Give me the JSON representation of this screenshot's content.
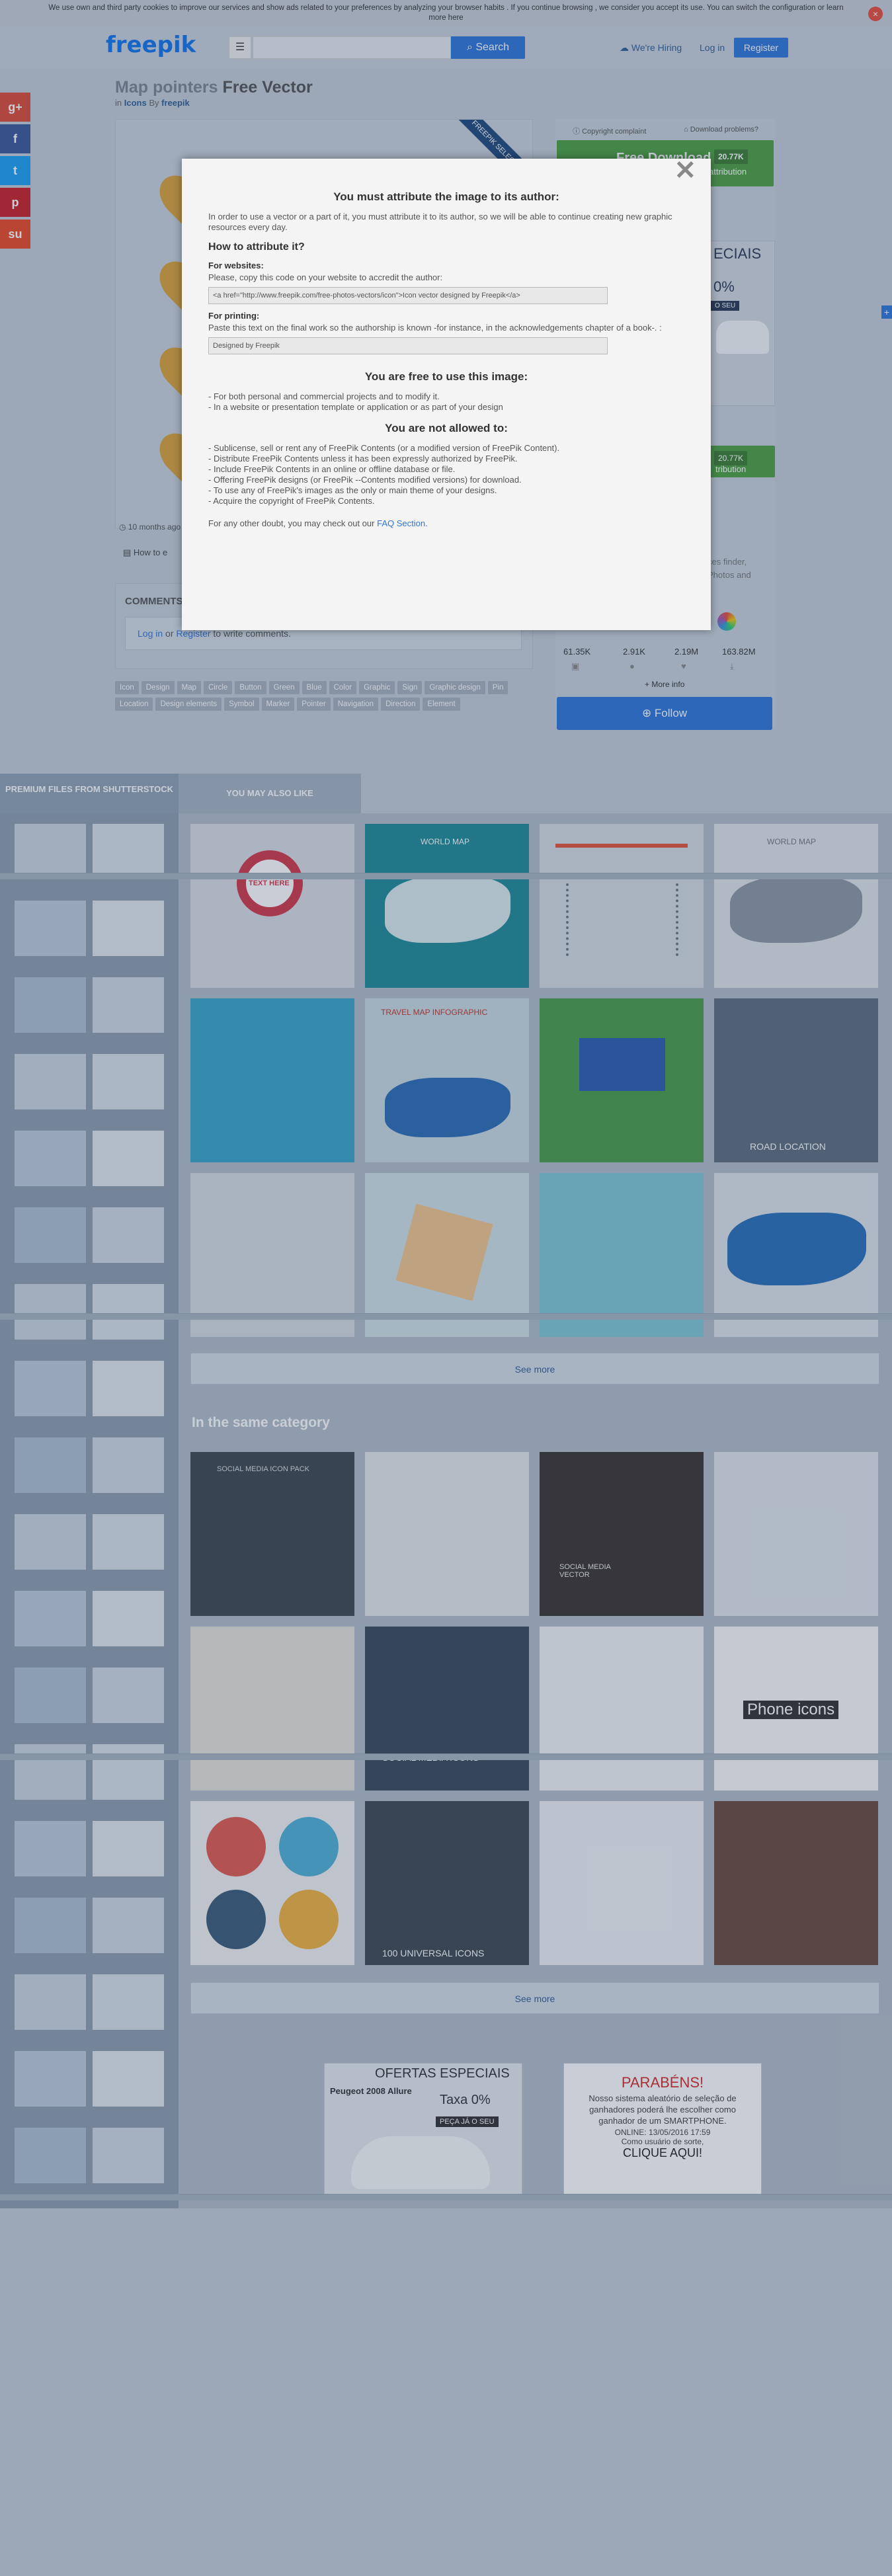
{
  "cookie": {
    "text": "We use own and third party cookies to improve our services and show ads related to your preferences by analyzing your browser habits . If you continue browsing , we consider you accept its use. You can switch the configuration or learn more here",
    "close": "×"
  },
  "header": {
    "logo": "freepik",
    "search_label": "Search",
    "hiring": "We're Hiring",
    "login": "Log in",
    "register": "Register"
  },
  "social": [
    "g+",
    "f",
    "t",
    "p",
    "su"
  ],
  "page": {
    "title_prefix": "Map pointers",
    "title_suffix": "Free Vector",
    "in": "in",
    "category": "Icons",
    "by": "By",
    "author": "freepik",
    "ribbon": "FREEPIK SELECTION",
    "meta": "10 months ago",
    "how_to": "How to e"
  },
  "side": {
    "copyright": "Copyright complaint",
    "download_problems": "Download problems?",
    "download": "Free Download",
    "download_count": "20.77K",
    "attribution": "attribution",
    "count2": "20.77K",
    "attribution2": "tribution",
    "finder_line1": "ces finder,",
    "finder_line2": "Photos and",
    "more_info": "+ More info",
    "follow": "Follow",
    "stats": [
      "61.35K",
      "2.91K",
      "2.19M",
      "163.82M"
    ]
  },
  "ad_side": {
    "headline": "ECIAIS",
    "sub": "0%",
    "cta": "O SEU"
  },
  "comments": {
    "title": "COMMENTS",
    "login": "Log in",
    "or": "or",
    "register": "Register",
    "rest": "to write comments."
  },
  "tags": [
    "Icon",
    "Design",
    "Map",
    "Circle",
    "Button",
    "Green",
    "Blue",
    "Color",
    "Graphic",
    "Sign",
    "Graphic design",
    "Pin",
    "Location",
    "Design elements",
    "Symbol",
    "Marker",
    "Pointer",
    "Navigation",
    "Direction",
    "Element"
  ],
  "sections": {
    "premium": "PREMIUM FILES FROM SHUTTERSTOCK",
    "also_like": "YOU MAY ALSO LIKE",
    "see_more": "See more",
    "same_category": "In the same category"
  },
  "thumb_texts": {
    "t1": "TEXT HERE",
    "t2": "WORLD MAP",
    "t3": "WORLD MAP",
    "t4": "TRAVEL MAP INFOGRAPHIC",
    "t5": "ROAD LOCATION",
    "t6": "SOCIAL MEDIA ICON PACK",
    "t7": "SOCIAL MEDIA VECTOR",
    "t8": "SOCIAL MEDIA ICONS",
    "t9": "Phone icons",
    "t10": "100 UNIVERSAL ICONS"
  },
  "ads": {
    "a1_title": "OFERTAS ESPECIAIS",
    "a1_car": "Peugeot 2008 Allure",
    "a1_rate": "Taxa 0%",
    "a1_cta": "PEÇA JÁ O SEU",
    "a2_title": "PARABÉNS!",
    "a2_body": "Nosso sistema aleatório de seleção de ganhadores poderá lhe escolher como ganhador de um SMARTPHONE.",
    "a2_online": "ONLINE: 13/05/2016 17:59",
    "a2_lucky": "Como usuário de sorte,",
    "a2_cta": "CLIQUE AQUI!"
  },
  "modal": {
    "title": "You must attribute the image to its author:",
    "intro": "In order to use a vector or a part of it, you must attribute it to its author, so we will be able to continue creating new graphic resources every day.",
    "how": "How to attribute it?",
    "web_title": "For websites:",
    "web_text": "Please, copy this code on your website to accredit the author:",
    "web_code": "<a href=\"http://www.freepik.com/free-photos-vectors/icon\">Icon vector designed by Freepik</a>",
    "print_title": "For printing:",
    "print_text": "Paste this text on the final work so the authorship is known -for instance, in the acknowledgements chapter of a book-. :",
    "print_code": "Designed by Freepik",
    "free_title": "You are free to use this image:",
    "free_items": [
      "- For both personal and commercial projects and to modify it.",
      "- In a website or presentation template or application or as part of your design"
    ],
    "notallowed_title": "You are not allowed to:",
    "notallowed_items": [
      "- Sublicense, sell or rent any of FreePik Contents (or a modified version of FreePik Content).",
      "- Distribute FreePik Contents unless it has been expressly authorized by FreePik.",
      "- Include FreePik Contents in an online or offline database or file.",
      "- Offering FreePik designs (or FreePik --Contents modified versions) for download.",
      "- To use any of FreePik's images as the only or main theme of your designs.",
      "- Acquire the copyright of FreePik Contents."
    ],
    "doubt": "For any other doubt, you may check out our",
    "faq": "FAQ Section.",
    "close": "✕"
  },
  "colors": {
    "brand": "#1273eb",
    "button_blue": "#2f76d8",
    "download_green": "#4e9f42"
  }
}
